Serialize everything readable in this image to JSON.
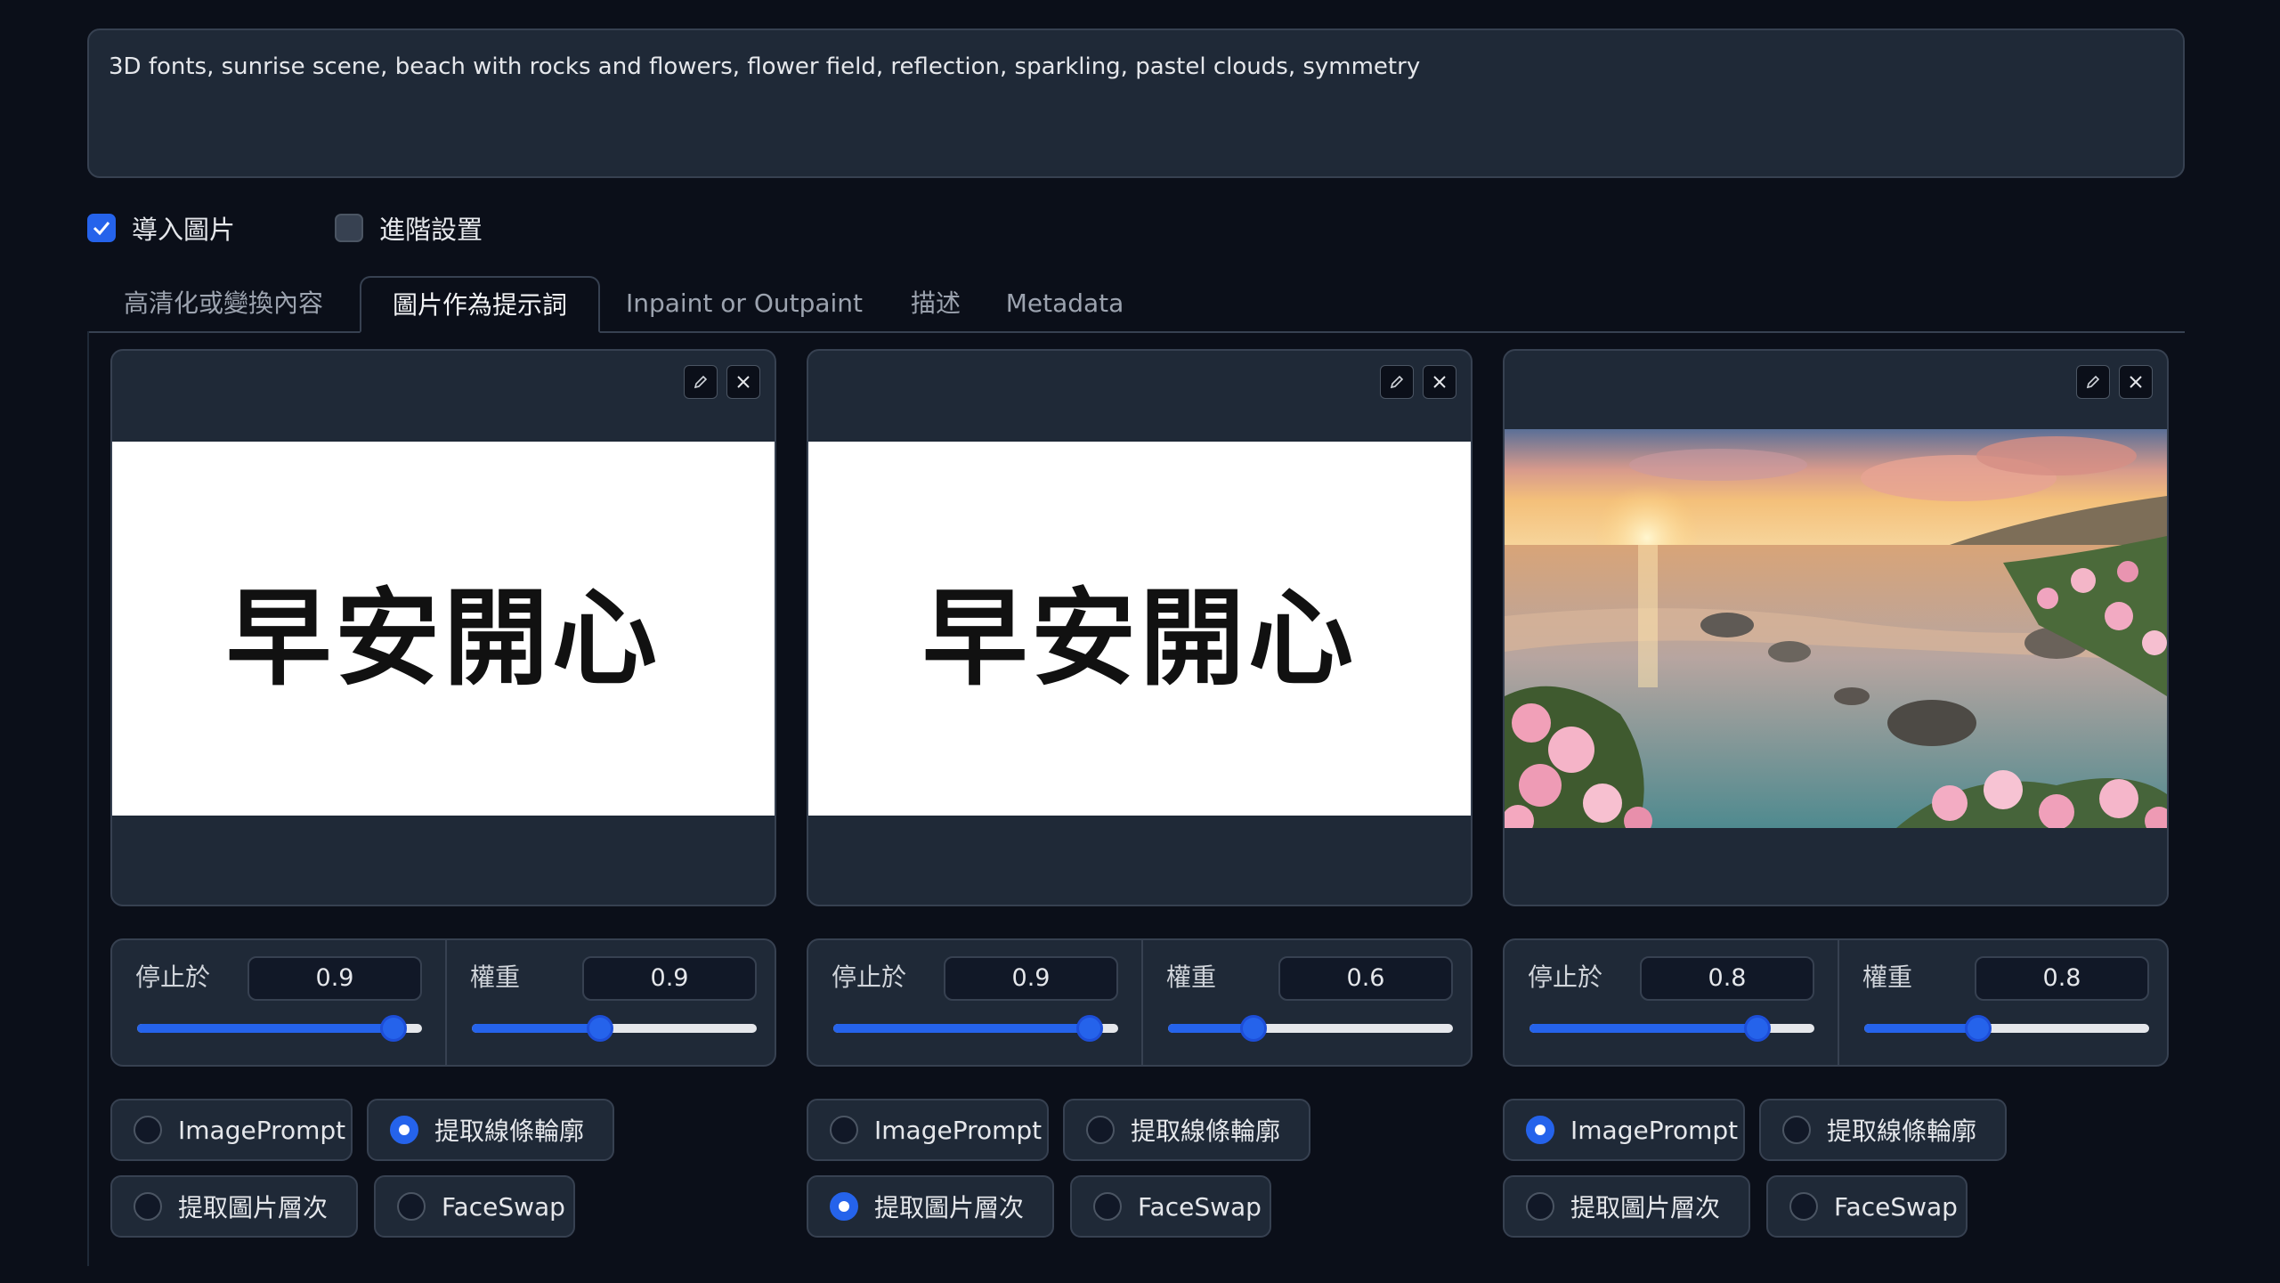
{
  "prompt": {
    "text": "3D fonts, sunrise scene, beach with rocks and flowers, flower field, reflection, sparkling, pastel clouds, symmetry"
  },
  "checkboxes": [
    {
      "label": "導入圖片",
      "checked": true
    },
    {
      "label": "進階設置",
      "checked": false
    }
  ],
  "tabs": [
    {
      "label": "高清化或變換內容",
      "active": false
    },
    {
      "label": "圖片作為提示詞",
      "active": true
    },
    {
      "label": "Inpaint or Outpaint",
      "active": false
    },
    {
      "label": "描述",
      "active": false
    },
    {
      "label": "Metadata",
      "active": false
    }
  ],
  "panels": [
    {
      "image_text": "早安開心",
      "stop_label": "停止於",
      "stop_value": "0.9",
      "stop_frac": 0.9,
      "weight_label": "權重",
      "weight_value": "0.9",
      "weight_frac": 0.45,
      "options": [
        {
          "label": "ImagePrompt",
          "selected": false
        },
        {
          "label": "提取線條輪廓",
          "selected": true
        },
        {
          "label": "提取圖片層次",
          "selected": false
        },
        {
          "label": "FaceSwap",
          "selected": false
        }
      ]
    },
    {
      "image_text": "早安開心",
      "stop_label": "停止於",
      "stop_value": "0.9",
      "stop_frac": 0.9,
      "weight_label": "權重",
      "weight_value": "0.6",
      "weight_frac": 0.3,
      "options": [
        {
          "label": "ImagePrompt",
          "selected": false
        },
        {
          "label": "提取線條輪廓",
          "selected": false
        },
        {
          "label": "提取圖片層次",
          "selected": true
        },
        {
          "label": "FaceSwap",
          "selected": false
        }
      ]
    },
    {
      "image_text": "",
      "stop_label": "停止於",
      "stop_value": "0.8",
      "stop_frac": 0.8,
      "weight_label": "權重",
      "weight_value": "0.8",
      "weight_frac": 0.4,
      "options": [
        {
          "label": "ImagePrompt",
          "selected": true
        },
        {
          "label": "提取線條輪廓",
          "selected": false
        },
        {
          "label": "提取圖片層次",
          "selected": false
        },
        {
          "label": "FaceSwap",
          "selected": false
        }
      ]
    }
  ],
  "colors": {
    "accent": "#2563eb",
    "panel": "#1f2937",
    "background": "#0b0f19",
    "border": "#374151"
  }
}
